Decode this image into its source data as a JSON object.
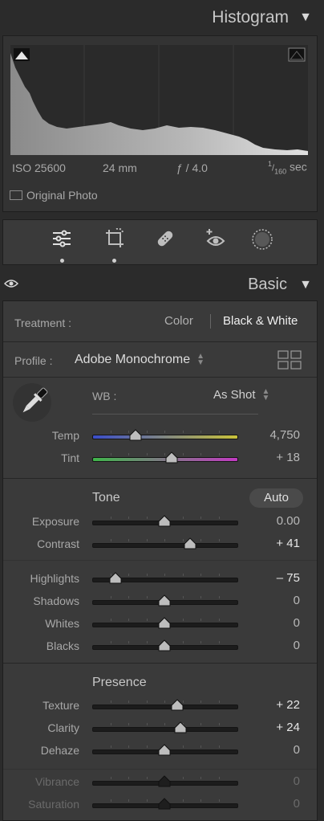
{
  "histogram": {
    "title": "Histogram",
    "iso": "ISO 25600",
    "focal": "24 mm",
    "aperture": "ƒ / 4.0",
    "shutter_num": "1",
    "shutter_den": "160",
    "shutter_unit": "sec",
    "original_label": "Original Photo"
  },
  "tools": [
    "edit-sliders-icon",
    "crop-icon",
    "healing-icon",
    "red-eye-icon",
    "masking-icon"
  ],
  "basic": {
    "title": "Basic",
    "treatment_label": "Treatment :",
    "treatment_color": "Color",
    "treatment_bw": "Black & White",
    "profile_label": "Profile :",
    "profile_value": "Adobe Monochrome",
    "wb_label": "WB :",
    "wb_value": "As Shot",
    "temp_label": "Temp",
    "temp_value": "4,750",
    "tint_label": "Tint",
    "tint_value": "+ 18",
    "tone_label": "Tone",
    "auto_label": "Auto",
    "presence_label": "Presence"
  },
  "sliders": [
    {
      "key": "temp",
      "label": "Temp",
      "value": "4,750",
      "pos": 0.3
    },
    {
      "key": "tint",
      "label": "Tint",
      "value": "+ 18",
      "pos": 0.55
    },
    {
      "key": "exposure",
      "label": "Exposure",
      "value": "0.00",
      "pos": 0.5
    },
    {
      "key": "contrast",
      "label": "Contrast",
      "value": "+ 41",
      "pos": 0.68
    },
    {
      "key": "highlights",
      "label": "Highlights",
      "value": "– 75",
      "pos": 0.16
    },
    {
      "key": "shadows",
      "label": "Shadows",
      "value": "0",
      "pos": 0.5
    },
    {
      "key": "whites",
      "label": "Whites",
      "value": "0",
      "pos": 0.5
    },
    {
      "key": "blacks",
      "label": "Blacks",
      "value": "0",
      "pos": 0.5
    },
    {
      "key": "texture",
      "label": "Texture",
      "value": "+ 22",
      "pos": 0.59
    },
    {
      "key": "clarity",
      "label": "Clarity",
      "value": "+ 24",
      "pos": 0.61
    },
    {
      "key": "dehaze",
      "label": "Dehaze",
      "value": "0",
      "pos": 0.5
    },
    {
      "key": "vibrance",
      "label": "Vibrance",
      "value": "0",
      "pos": 0.5
    },
    {
      "key": "saturation",
      "label": "Saturation",
      "value": "0",
      "pos": 0.5
    }
  ],
  "colors": {
    "temp_left": "#3a4dc9",
    "temp_right": "#c9c23a",
    "tint_left": "#3fb54a",
    "tint_right": "#c23ac2"
  }
}
